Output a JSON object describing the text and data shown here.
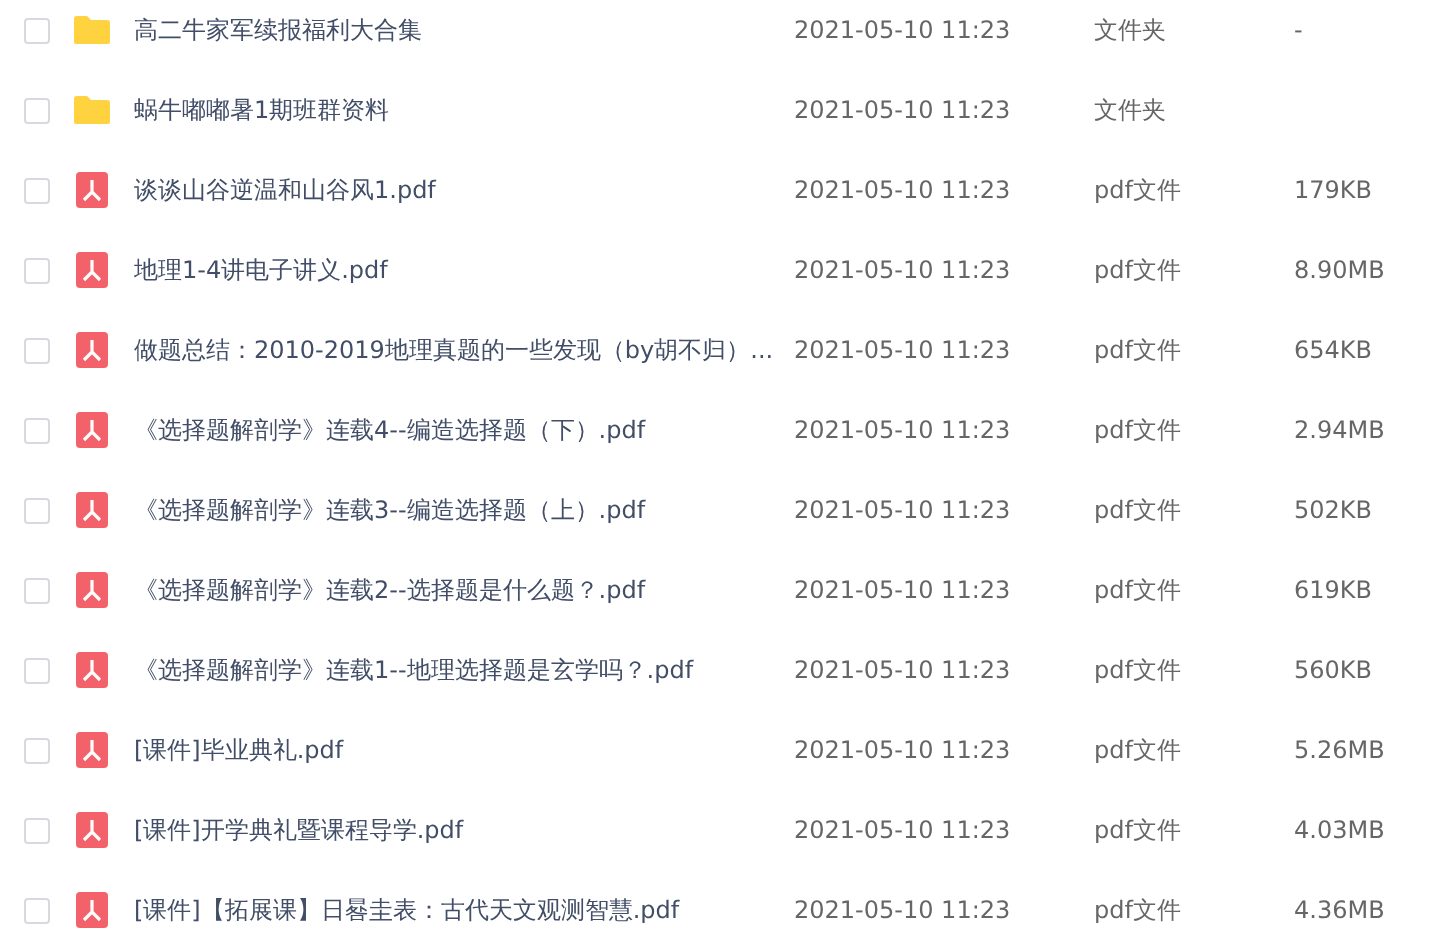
{
  "files": [
    {
      "kind": "folder",
      "checked": false,
      "name": "高二牛家军续报福利大合集",
      "date": "2021-05-10 11:23",
      "type": "文件夹",
      "size": "-"
    },
    {
      "kind": "folder",
      "checked": false,
      "name": "蜗牛嘟嘟暑1期班群资料",
      "date": "2021-05-10 11:23",
      "type": "文件夹"
    },
    {
      "kind": "pdf",
      "checked": false,
      "name": "谈谈山谷逆温和山谷风1.pdf",
      "date": "2021-05-10 11:23",
      "type": "pdf文件",
      "size": "179KB"
    },
    {
      "kind": "pdf",
      "checked": false,
      "name": "地理1-4讲电子讲义.pdf",
      "date": "2021-05-10 11:23",
      "type": "pdf文件",
      "size": "8.90MB"
    },
    {
      "kind": "pdf",
      "checked": false,
      "name": "做题总结：2010-2019地理真题的一些发现（by胡不归）...",
      "date": "2021-05-10 11:23",
      "type": "pdf文件",
      "size": "654KB"
    },
    {
      "kind": "pdf",
      "checked": false,
      "name": "《选择题解剖学》连载4--编造选择题（下）.pdf",
      "date": "2021-05-10 11:23",
      "type": "pdf文件",
      "size": "2.94MB"
    },
    {
      "kind": "pdf",
      "checked": false,
      "name": "《选择题解剖学》连载3--编造选择题（上）.pdf",
      "date": "2021-05-10 11:23",
      "type": "pdf文件",
      "size": "502KB"
    },
    {
      "kind": "pdf",
      "checked": false,
      "name": "《选择题解剖学》连载2--选择题是什么题？.pdf",
      "date": "2021-05-10 11:23",
      "type": "pdf文件",
      "size": "619KB"
    },
    {
      "kind": "pdf",
      "checked": false,
      "name": "《选择题解剖学》连载1--地理选择题是玄学吗？.pdf",
      "date": "2021-05-10 11:23",
      "type": "pdf文件",
      "size": "560KB"
    },
    {
      "kind": "pdf",
      "checked": false,
      "name": "[课件]毕业典礼.pdf",
      "date": "2021-05-10 11:23",
      "type": "pdf文件",
      "size": "5.26MB"
    },
    {
      "kind": "pdf",
      "checked": false,
      "name": "[课件]开学典礼暨课程导学.pdf",
      "date": "2021-05-10 11:23",
      "type": "pdf文件",
      "size": "4.03MB"
    },
    {
      "kind": "pdf",
      "checked": false,
      "name": "[课件]【拓展课】日晷圭表：古代天文观测智慧.pdf",
      "date": "2021-05-10 11:23",
      "type": "pdf文件",
      "size": "4.36MB"
    }
  ]
}
